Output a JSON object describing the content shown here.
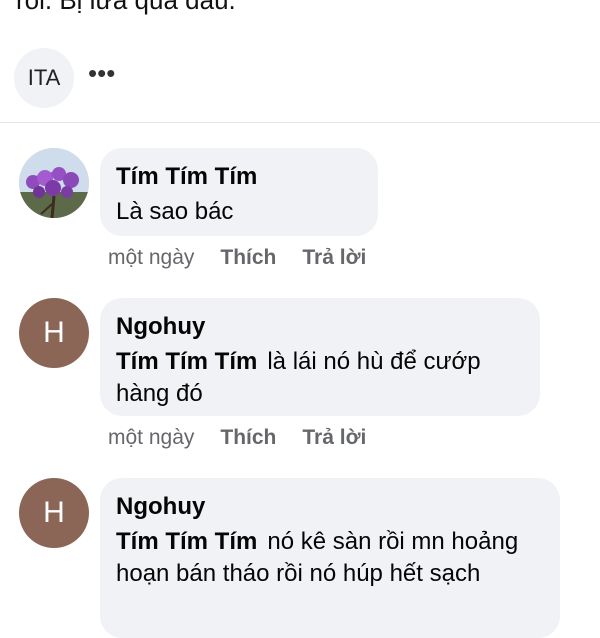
{
  "post": {
    "text_tail": "rồi. Bị lừa quá đau."
  },
  "reactions": {
    "pill_label": "ITA",
    "more_label": "•••"
  },
  "comments": [
    {
      "avatar_letter": "",
      "author": "Tím Tím Tím",
      "mention": "",
      "text": "Là sao bác",
      "time": "một ngày",
      "like": "Thích",
      "reply": "Trả lời"
    },
    {
      "avatar_letter": "H",
      "author": "Ngohuy",
      "mention": "Tím Tím Tím",
      "text": "là lái nó hù để cướp hàng đó",
      "time": "một ngày",
      "like": "Thích",
      "reply": "Trả lời"
    },
    {
      "avatar_letter": "H",
      "author": "Ngohuy",
      "mention": "Tím Tím Tím",
      "text": "nó kê sàn rồi mn hoảng hoạn bán tháo rồi nó húp hết sạch"
    }
  ],
  "colors": {
    "bubble": "#f0f2f5",
    "avatar_h": "#8b6656",
    "meta_text": "#65676b",
    "divider": "#e4e6eb"
  }
}
